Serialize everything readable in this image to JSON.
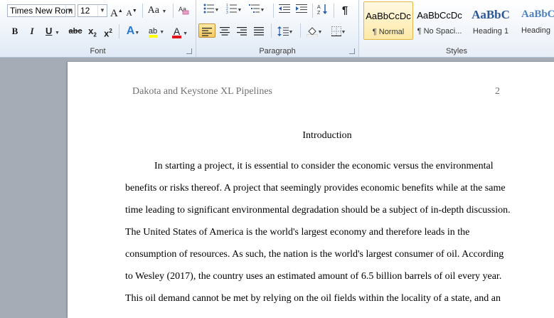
{
  "ribbon": {
    "font": {
      "font_name": "Times New Rom",
      "font_size": "12",
      "grow_glyph": "A",
      "shrink_glyph": "A",
      "case_glyph": "Aa",
      "bold": "B",
      "italic": "I",
      "underline": "U",
      "strike": "abc",
      "subscript": "x",
      "superscript": "x",
      "effects_glyph": "A",
      "highlight_glyph": "ab",
      "fontcolor_glyph": "A",
      "label": "Font"
    },
    "paragraph": {
      "label": "Paragraph",
      "pilcrow": "¶"
    },
    "styles": {
      "label": "Styles",
      "items": [
        {
          "sample": "AaBbCcDc",
          "name": "¶ Normal"
        },
        {
          "sample": "AaBbCcDc",
          "name": "¶ No Spaci..."
        },
        {
          "sample": "AaBbC",
          "name": "Heading 1"
        },
        {
          "sample": "AaBbC",
          "name": "Heading"
        }
      ]
    }
  },
  "document": {
    "header": "Dakota and Keystone XL Pipelines",
    "page_number": "2",
    "title": "Introduction",
    "lines": [
      "In starting a project, it is essential to consider the economic versus the environmental",
      "benefits or risks thereof. A project that seemingly provides economic benefits while at the same",
      "time leading to significant environmental degradation should be a subject of in-depth discussion.",
      "The United States of America is the world's largest economy and therefore leads in the",
      "consumption of resources. As such, the nation is the world's largest consumer of oil. According",
      "to Wesley (2017), the country uses an estimated amount of 6.5 billion barrels of oil every year.",
      "This oil demand cannot be met by relying on the oil fields within the locality of a state, and an"
    ]
  }
}
